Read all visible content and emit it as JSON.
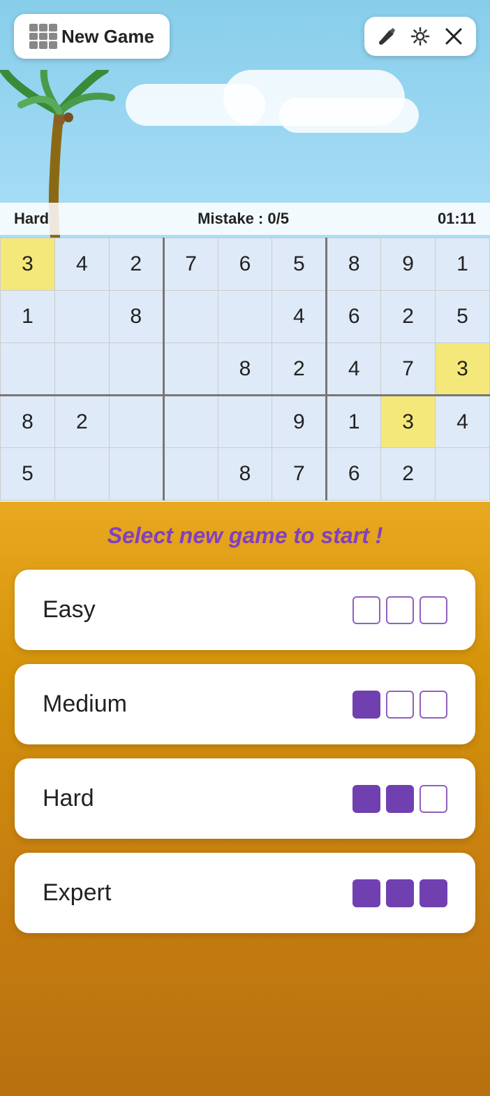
{
  "topBar": {
    "newGameLabel": "New Game",
    "paintIcon": "🖌",
    "settingsIcon": "⚙",
    "closeIcon": "✕"
  },
  "statusBar": {
    "difficulty": "Hard",
    "mistakeLabel": "Mistake : 0/5",
    "timer": "01:11"
  },
  "sudokuGrid": {
    "rows": [
      [
        {
          "value": "3",
          "type": "highlight-yellow"
        },
        {
          "value": "4",
          "type": "normal"
        },
        {
          "value": "2",
          "type": "normal"
        },
        {
          "value": "7",
          "type": "normal"
        },
        {
          "value": "6",
          "type": "normal"
        },
        {
          "value": "5",
          "type": "normal"
        },
        {
          "value": "8",
          "type": "normal"
        },
        {
          "value": "9",
          "type": "normal"
        },
        {
          "value": "1",
          "type": "normal"
        }
      ],
      [
        {
          "value": "1",
          "type": "normal"
        },
        {
          "value": "",
          "type": "normal"
        },
        {
          "value": "8",
          "type": "normal"
        },
        {
          "value": "",
          "type": "normal"
        },
        {
          "value": "",
          "type": "normal"
        },
        {
          "value": "4",
          "type": "normal"
        },
        {
          "value": "6",
          "type": "normal"
        },
        {
          "value": "2",
          "type": "normal"
        },
        {
          "value": "5",
          "type": "normal"
        }
      ],
      [
        {
          "value": "",
          "type": "normal"
        },
        {
          "value": "",
          "type": "normal"
        },
        {
          "value": "",
          "type": "normal"
        },
        {
          "value": "",
          "type": "normal"
        },
        {
          "value": "8",
          "type": "normal"
        },
        {
          "value": "2",
          "type": "normal"
        },
        {
          "value": "4",
          "type": "normal"
        },
        {
          "value": "7",
          "type": "normal"
        },
        {
          "value": "3",
          "type": "highlight-yellow"
        }
      ],
      [
        {
          "value": "8",
          "type": "normal"
        },
        {
          "value": "2",
          "type": "normal"
        },
        {
          "value": "",
          "type": "normal"
        },
        {
          "value": "",
          "type": "normal"
        },
        {
          "value": "",
          "type": "normal"
        },
        {
          "value": "9",
          "type": "normal"
        },
        {
          "value": "1",
          "type": "normal"
        },
        {
          "value": "3",
          "type": "highlight-yellow"
        },
        {
          "value": "4",
          "type": "normal"
        }
      ],
      [
        {
          "value": "5",
          "type": "normal"
        },
        {
          "value": "",
          "type": "normal"
        },
        {
          "value": "",
          "type": "normal"
        },
        {
          "value": "",
          "type": "normal"
        },
        {
          "value": "8",
          "type": "normal"
        },
        {
          "value": "7",
          "type": "normal"
        },
        {
          "value": "6",
          "type": "normal"
        },
        {
          "value": "2",
          "type": "normal"
        },
        {
          "value": "",
          "type": "normal"
        }
      ]
    ]
  },
  "overlay": {
    "selectText": "Select new game to start !",
    "difficulties": [
      {
        "label": "Easy",
        "filledDots": 0,
        "totalDots": 3
      },
      {
        "label": "Medium",
        "filledDots": 1,
        "totalDots": 3
      },
      {
        "label": "Hard",
        "filledDots": 2,
        "totalDots": 3
      },
      {
        "label": "Expert",
        "filledDots": 3,
        "totalDots": 3
      }
    ]
  }
}
